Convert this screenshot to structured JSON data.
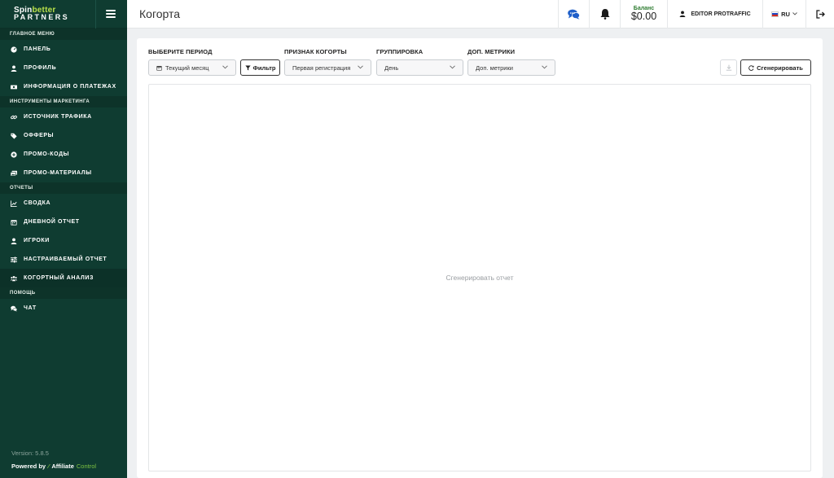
{
  "brand": {
    "logo_line1_a": "Spin",
    "logo_line1_b": "better",
    "logo_line2": "PARTNERS"
  },
  "sidebar": {
    "sections": [
      {
        "title": "ГЛАВНОЕ МЕНЮ",
        "items": [
          {
            "label": "ПАНЕЛЬ",
            "icon": "dashboard-icon"
          },
          {
            "label": "ПРОФИЛЬ",
            "icon": "user-icon"
          },
          {
            "label": "ИНФОРМАЦИЯ О ПЛАТЕЖАХ",
            "icon": "money-icon"
          }
        ]
      },
      {
        "title": "ИНСТРУМЕНТЫ МАРКЕТИНГА",
        "items": [
          {
            "label": "ИСТОЧНИК ТРАФИКА",
            "icon": "link-icon"
          },
          {
            "label": "ОФФЕРЫ",
            "icon": "tags-icon"
          },
          {
            "label": "ПРОМО-КОДЫ",
            "icon": "plus-circle-icon"
          },
          {
            "label": "ПРОМО-МАТЕРИАЛЫ",
            "icon": "images-icon"
          }
        ]
      },
      {
        "title": "ОТЧЕТЫ",
        "items": [
          {
            "label": "СВОДКА",
            "icon": "chart-icon"
          },
          {
            "label": "ДНЕВНОЙ ОТЧЕТ",
            "icon": "calendar-icon"
          },
          {
            "label": "ИГРОКИ",
            "icon": "user-icon"
          },
          {
            "label": "НАСТРАИВАЕМЫЙ ОТЧЕТ",
            "icon": "sliders-icon"
          },
          {
            "label": "КОГОРТНЫЙ АНАЛИЗ",
            "icon": "users-icon"
          }
        ]
      },
      {
        "title": "ПОМОЩЬ",
        "items": [
          {
            "label": "ЧАТ",
            "icon": "comments-icon"
          }
        ]
      }
    ],
    "version": "Version: 5.8.5",
    "powered_by": "Powered by",
    "powered_brand_a": "Affiliate",
    "powered_brand_b": "Control"
  },
  "header": {
    "title": "Когорта",
    "balance_label": "Баланс",
    "balance_value": "$0.00",
    "user_name": "EDITOR PROTRAFFIC",
    "language": "RU"
  },
  "filters": {
    "period_label": "ВЫБЕРИТЕ ПЕРИОД",
    "period_value": "Текущий месяц",
    "filter_button": "Фильтр",
    "cohort_label": "ПРИЗНАК КОГОРТЫ",
    "cohort_value": "Первая регистрация",
    "grouping_label": "ГРУППИРОВКА",
    "grouping_value": "День",
    "metrics_label": "ДОП. МЕТРИКИ",
    "metrics_value": "Доп. метрики"
  },
  "actions": {
    "generate_button": "Сгенерировать"
  },
  "report": {
    "empty_text": "Сгенерировать отчет"
  },
  "colors": {
    "sidebar_bg": "#0f3c31",
    "accent": "#b8e04a",
    "balance": "#2f7d32",
    "chat_icon": "#1f5fc9"
  }
}
